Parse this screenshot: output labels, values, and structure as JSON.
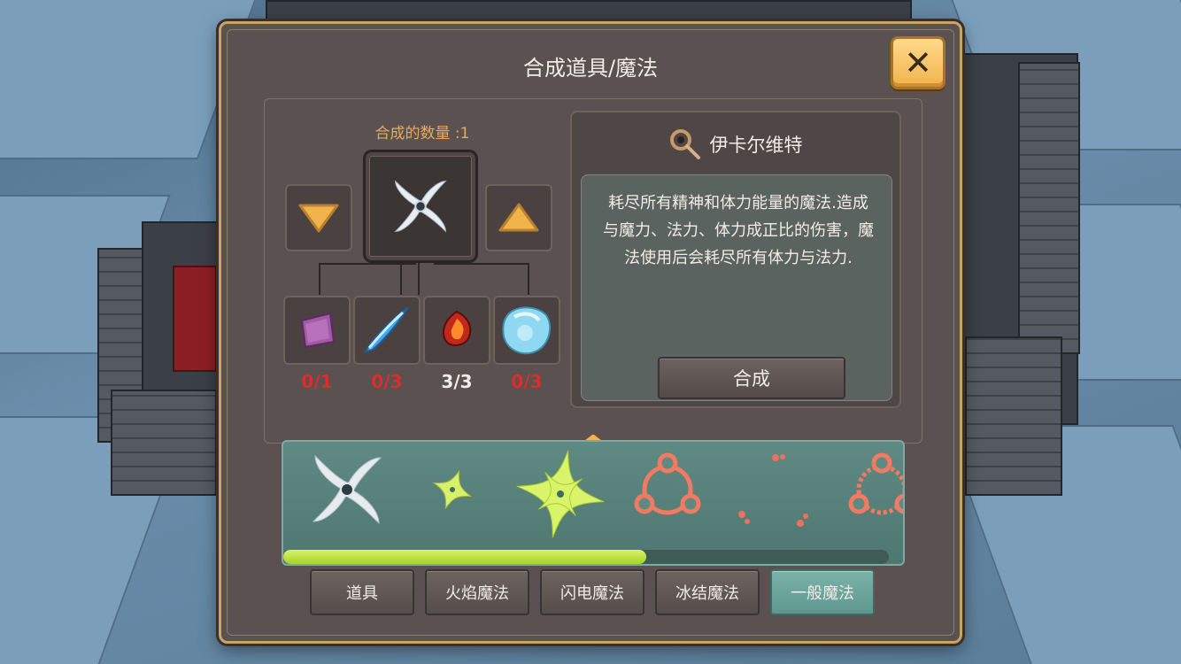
{
  "dialog": {
    "title": "合成道具/魔法",
    "close_icon": "✕"
  },
  "craft": {
    "count_label": "合成的数量 :1",
    "decrease_icon": "triangle-down",
    "increase_icon": "triangle-up",
    "result_icon": "whirlwind-shuriken",
    "materials": [
      {
        "icon": "purple-cloth",
        "count": "0/1",
        "status": "insufficient"
      },
      {
        "icon": "ice-shard",
        "count": "0/3",
        "status": "insufficient"
      },
      {
        "icon": "fire-gem",
        "count": "3/3",
        "status": "sufficient"
      },
      {
        "icon": "ice-crystal",
        "count": "0/3",
        "status": "insufficient"
      }
    ]
  },
  "info": {
    "name": "伊卡尔维特",
    "icon": "magic-staff",
    "description": "耗尽所有精神和体力能量的魔法.造成与魔力、法力、体力成正比的伤害，魔法使用后会耗尽所有体力与法力.",
    "craft_button": "合成"
  },
  "carousel": {
    "recipes": [
      {
        "icon": "white-shuriken",
        "selected": true
      },
      {
        "icon": "small-green-star",
        "selected": false
      },
      {
        "icon": "large-green-star",
        "selected": false
      },
      {
        "icon": "red-ring-rune",
        "selected": false
      },
      {
        "icon": "red-scatter-dots",
        "selected": false
      },
      {
        "icon": "red-ring-rune",
        "selected": false
      }
    ],
    "scroll_progress": 0.6
  },
  "tabs": [
    {
      "label": "道具",
      "active": false
    },
    {
      "label": "火焰魔法",
      "active": false
    },
    {
      "label": "闪电魔法",
      "active": false
    },
    {
      "label": "冰结魔法",
      "active": false
    },
    {
      "label": "一般魔法",
      "active": true
    }
  ],
  "colors": {
    "accent_gold": "#f1b34d",
    "count_label": "#eaa95b",
    "insufficient": "#e12a2a",
    "active_tab": "#6ea59c"
  }
}
